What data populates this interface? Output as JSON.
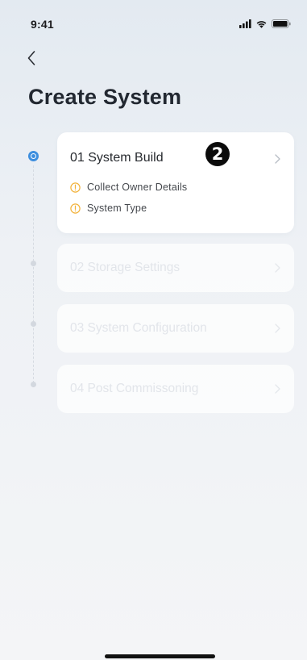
{
  "status_bar": {
    "time": "9:41",
    "icons": [
      "signal-icon",
      "wifi-icon",
      "battery-icon"
    ]
  },
  "nav": {
    "back_icon": "chevron-left-icon"
  },
  "page": {
    "title": "Create System"
  },
  "steps": [
    {
      "label": "01 System Build",
      "state": "active",
      "badge": "2",
      "items": [
        {
          "label": "Collect Owner Details",
          "icon": "warning-icon"
        },
        {
          "label": "System Type",
          "icon": "warning-icon"
        }
      ]
    },
    {
      "label": "02 Storage Settings",
      "state": "disabled"
    },
    {
      "label": "03 System Configuration",
      "state": "disabled"
    },
    {
      "label": "04 Post Commissoning",
      "state": "disabled"
    }
  ],
  "colors": {
    "accent": "#3d8ede",
    "warning": "#f2b23a",
    "title": "#222831",
    "disabled_text": "#e2e5ea"
  }
}
